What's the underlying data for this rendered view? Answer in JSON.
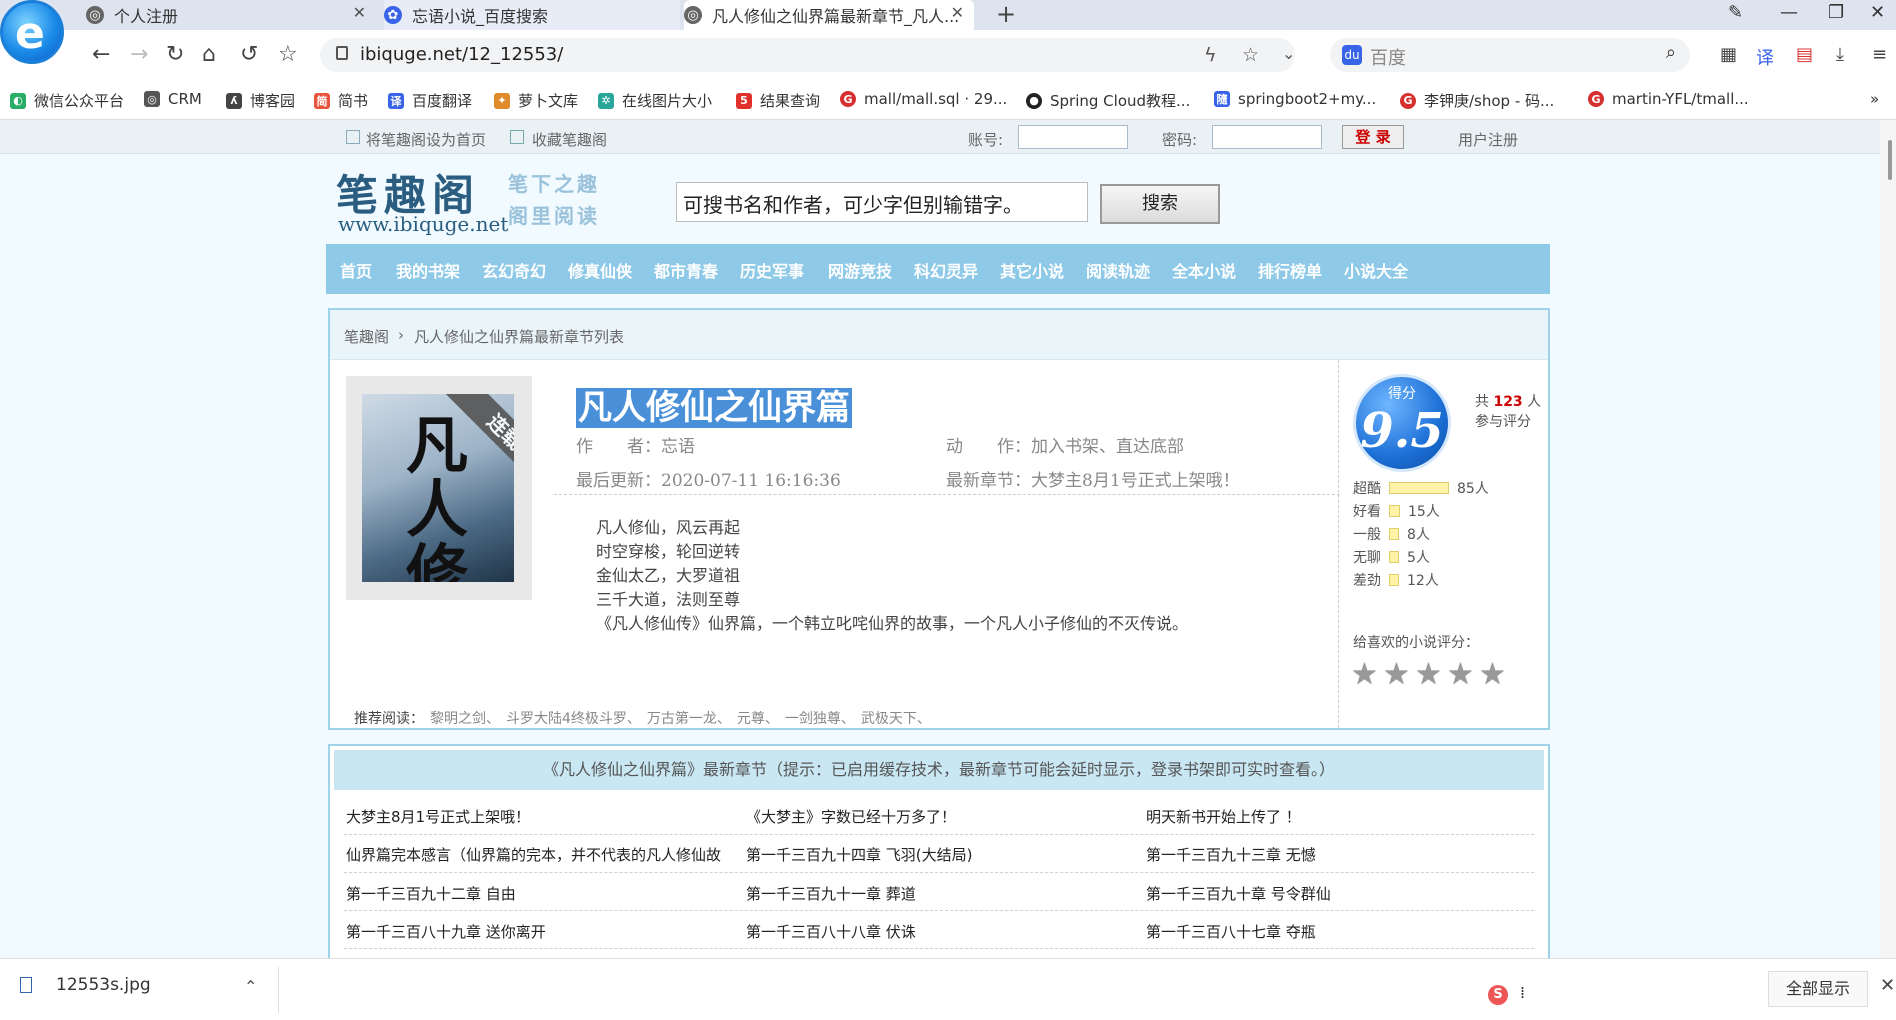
{
  "browser": {
    "tabs": [
      {
        "title": "个人注册"
      },
      {
        "title": "忘语小说_百度搜索"
      },
      {
        "title": "凡人修仙之仙界篇最新章节_凡人..."
      }
    ],
    "url": "ibiquge.net/12_12553/",
    "search_placeholder": "百度",
    "bookmarks": [
      {
        "label": "微信公众平台",
        "color": "#2aae67"
      },
      {
        "label": "CRM",
        "color": "#555555"
      },
      {
        "label": "博客园",
        "color": "#444444"
      },
      {
        "label": "简书",
        "color": "#e8543d"
      },
      {
        "label": "百度翻译",
        "color": "#3a64e8"
      },
      {
        "label": "萝卜文库",
        "color": "#e08a2a"
      },
      {
        "label": "在线图片大小",
        "color": "#2aa59a"
      },
      {
        "label": "结果查询",
        "color": "#e0302a"
      },
      {
        "label": "mall/mall.sql · 29...",
        "color": "#d62f2f"
      },
      {
        "label": "Spring Cloud教程...",
        "color": "#222222"
      },
      {
        "label": "springboot2+my...",
        "color": "#3a64e8"
      },
      {
        "label": "李钾庚/shop - 码...",
        "color": "#d62f2f"
      },
      {
        "label": "martin-YFL/tmall...",
        "color": "#d62f2f"
      }
    ],
    "bookmarks_more": "»"
  },
  "site": {
    "topbar": {
      "set_home": "将笔趣阁设为首页",
      "bookmark_site": "收藏笔趣阁",
      "account_label": "账号:",
      "password_label": "密码:",
      "login_button": "登 录",
      "register": "用户注册"
    },
    "logo": {
      "name": "笔趣阁",
      "url": "www.ibiquge.net",
      "slogan_1": "笔下之趣",
      "slogan_2": "阁里阅读"
    },
    "search": {
      "placeholder": "可搜书名和作者，可少字但别输错字。",
      "button": "搜索"
    },
    "nav": [
      "首页",
      "我的书架",
      "玄幻奇幻",
      "修真仙侠",
      "都市青春",
      "历史军事",
      "网游竞技",
      "科幻灵异",
      "其它小说",
      "阅读轨迹",
      "全本小说",
      "排行榜单",
      "小说大全"
    ],
    "breadcrumb": {
      "home": "笔趣阁",
      "separator": "›",
      "current": "凡人修仙之仙界篇最新章节列表"
    }
  },
  "book": {
    "cover_text": "凡人修仙",
    "status_ribbon": "连载中",
    "title": "凡人修仙之仙界篇",
    "author_label": "作　　者：",
    "author": "忘语",
    "action_label": "动　　作：",
    "action": "加入书架、直达底部",
    "updated_label": "最后更新：",
    "updated": "2020-07-11 16:16:36",
    "latest_label": "最新章节：",
    "latest": "大梦主8月1号正式上架哦！",
    "description": [
      "凡人修仙，风云再起",
      "时空穿梭，轮回逆转",
      "金仙太乙，大罗道祖",
      "三千大道，法则至尊",
      "《凡人修仙传》仙界篇，一个韩立叱咤仙界的故事，一个凡人小子修仙的不灭传说。"
    ],
    "recommend_label": "推荐阅读：",
    "recommend": [
      "黎明之剑、",
      "斗罗大陆4终极斗罗、",
      "万古第一龙、",
      "元尊、",
      "一剑独尊、",
      "武极天下、"
    ]
  },
  "rating": {
    "score_label": "得分",
    "score": "9.5",
    "total_prefix": "共",
    "total_count": "123",
    "total_suffix": "人",
    "total_line2": "参与评分",
    "levels": [
      {
        "label": "超酷",
        "count": "85人",
        "value": 85
      },
      {
        "label": "好看",
        "count": "15人",
        "value": 15
      },
      {
        "label": "一般",
        "count": "8人",
        "value": 8
      },
      {
        "label": "无聊",
        "count": "5人",
        "value": 5
      },
      {
        "label": "差劲",
        "count": "12人",
        "value": 12
      }
    ],
    "prompt": "给喜欢的小说评分：",
    "stars": 5
  },
  "chapters": {
    "header": "《凡人修仙之仙界篇》最新章节（提示：已启用缓存技术，最新章节可能会延时显示，登录书架即可实时查看。）",
    "rows": [
      [
        "大梦主8月1号正式上架哦！",
        "《大梦主》字数已经十万多了！",
        "明天新书开始上传了 ！"
      ],
      [
        "仙界篇完本感言（仙界篇的完本，并不代表的凡人修仙故",
        "第一千三百九十四章 飞羽(大结局)",
        "第一千三百九十三章 无憾"
      ],
      [
        "第一千三百九十二章 自由",
        "第一千三百九十一章 葬道",
        "第一千三百九十章 号令群仙"
      ],
      [
        "第一千三百八十九章 送你离开",
        "第一千三百八十八章 伏诛",
        "第一千三百八十七章 夺瓶"
      ]
    ]
  },
  "download": {
    "file": "12553s.jpg",
    "show_all": "全部显示"
  }
}
